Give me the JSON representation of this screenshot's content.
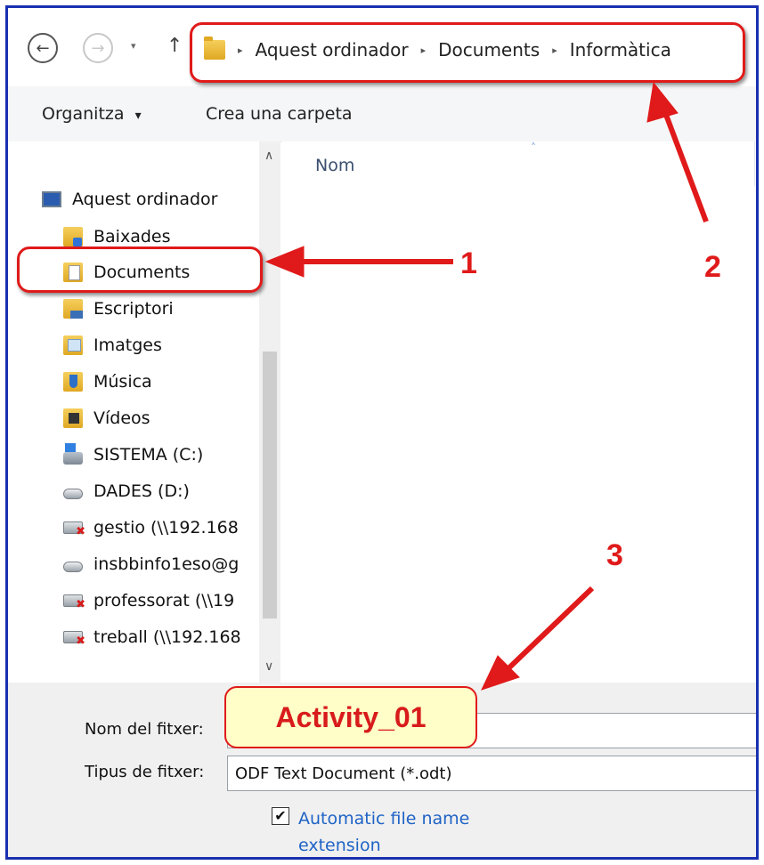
{
  "nav": {
    "back": "←",
    "forward": "→",
    "recent": "▾",
    "up": "↑",
    "breadcrumb": [
      "Aquest ordinador",
      "Documents",
      "Informàtica"
    ],
    "sep": "▸"
  },
  "toolbar": {
    "organize_label": "Organitza",
    "organize_caret": "▾",
    "new_folder_label": "Crea una carpeta"
  },
  "sidebar": {
    "scroll_up": "∧",
    "scroll_down": "∨",
    "items": [
      {
        "label": "Aquest ordinador",
        "icon": "computer-icon"
      },
      {
        "label": "Baixades",
        "icon": "downloads-folder-icon"
      },
      {
        "label": "Documents",
        "icon": "documents-folder-icon"
      },
      {
        "label": "Escriptori",
        "icon": "desktop-folder-icon"
      },
      {
        "label": "Imatges",
        "icon": "pictures-folder-icon"
      },
      {
        "label": "Música",
        "icon": "music-folder-icon"
      },
      {
        "label": "Vídeos",
        "icon": "videos-folder-icon"
      },
      {
        "label": "SISTEMA (C:)",
        "icon": "system-drive-icon"
      },
      {
        "label": "DADES (D:)",
        "icon": "drive-icon"
      },
      {
        "label": "gestio (\\\\192.168",
        "icon": "network-drive-disconnected-icon"
      },
      {
        "label": "insbbinfo1eso@g",
        "icon": "drive-icon"
      },
      {
        "label": "professorat (\\\\19",
        "icon": "network-drive-disconnected-icon"
      },
      {
        "label": "treball (\\\\192.168",
        "icon": "network-drive-disconnected-icon"
      }
    ]
  },
  "content": {
    "column_name": "Nom",
    "sort_caret": "˄"
  },
  "form": {
    "filename_label": "Nom del fitxer:",
    "filename_value": "Activity_01",
    "filetype_label": "Tipus de fitxer:",
    "filetype_value": "ODF Text Document (*.odt)",
    "auto_ext_checked_mark": "✔",
    "auto_ext_label": "Automatic file name extension"
  },
  "annotations": {
    "labels": [
      "1",
      "2",
      "3"
    ],
    "color": "#e01a1a"
  }
}
